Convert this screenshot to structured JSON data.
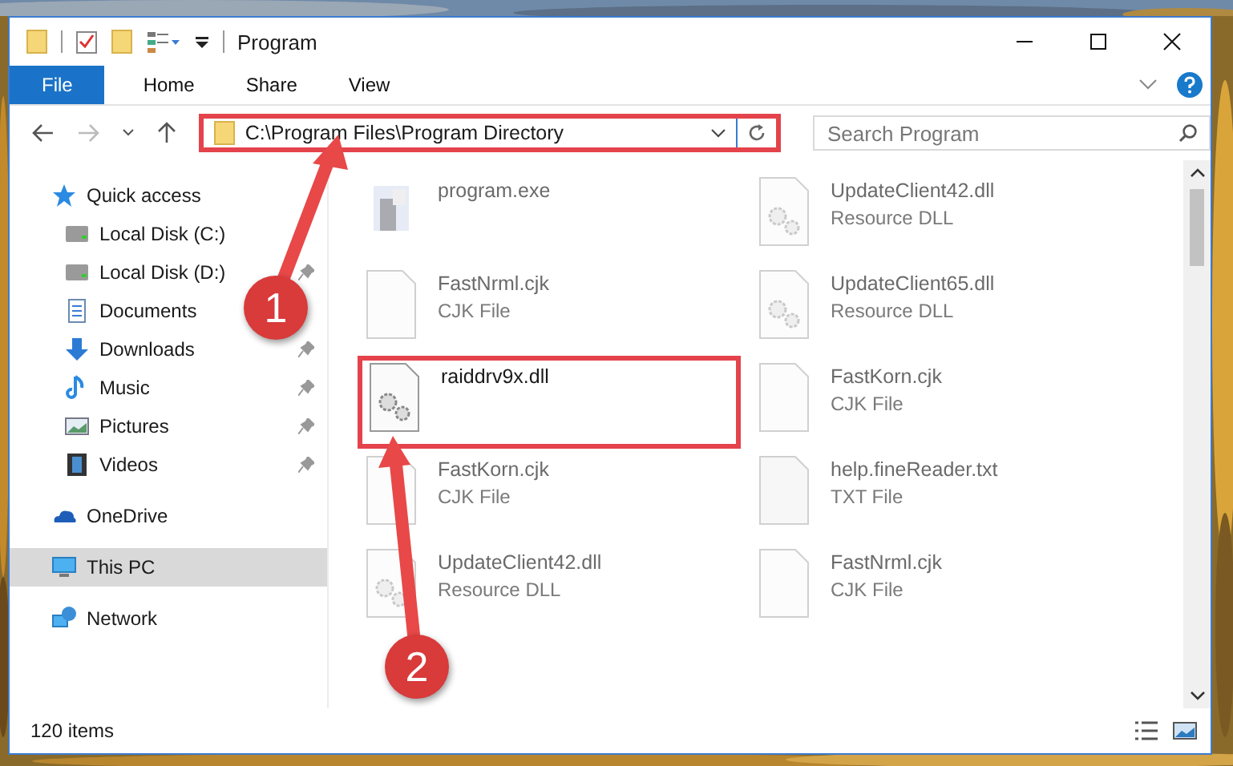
{
  "window": {
    "title": "Program"
  },
  "ribbon_tabs": [
    {
      "label": "File",
      "selected": true
    },
    {
      "label": "Home",
      "selected": false
    },
    {
      "label": "Share",
      "selected": false
    },
    {
      "label": "View",
      "selected": false
    }
  ],
  "address": {
    "path": "C:\\Program Files\\Program Directory",
    "highlighted": true
  },
  "search": {
    "placeholder": "Search Program"
  },
  "sidebar": {
    "items": [
      {
        "label": "Quick access",
        "kind": "star",
        "selected": false,
        "children": [
          {
            "label": "Local Disk (C:)",
            "kind": "drive",
            "pinned": false,
            "selected": false
          },
          {
            "label": "Local Disk (D:)",
            "kind": "drive",
            "pinned": true,
            "selected": false
          },
          {
            "label": "Documents",
            "kind": "document",
            "pinned": false,
            "selected": false
          },
          {
            "label": "Downloads",
            "kind": "download",
            "pinned": true,
            "selected": false
          },
          {
            "label": "Music",
            "kind": "music",
            "pinned": true,
            "selected": false
          },
          {
            "label": "Pictures",
            "kind": "pictures",
            "pinned": true,
            "selected": false
          },
          {
            "label": "Videos",
            "kind": "videos",
            "pinned": true,
            "selected": false
          }
        ]
      },
      {
        "label": "OneDrive",
        "kind": "cloud",
        "selected": false
      },
      {
        "label": "This PC",
        "kind": "pc",
        "selected": true
      },
      {
        "label": "Network",
        "kind": "network",
        "selected": false
      }
    ]
  },
  "files": [
    {
      "name": "program.exe",
      "kind": "exe",
      "blurred": true,
      "highlighted": false
    },
    {
      "name": "UpdateClient42.dll",
      "type": "Resource DLL",
      "kind": "dll",
      "blurred": true,
      "highlighted": false
    },
    {
      "name": "FastNrml.cjk",
      "type": "CJK File",
      "kind": "file",
      "blurred": true,
      "highlighted": false
    },
    {
      "name": "UpdateClient65.dll",
      "type": "Resource DLL",
      "kind": "dll",
      "blurred": true,
      "highlighted": false
    },
    {
      "name": "raiddrv9x.dll",
      "kind": "dll",
      "blurred": false,
      "highlighted": true
    },
    {
      "name": "FastKorn.cjk",
      "type": "CJK File",
      "kind": "file",
      "blurred": true,
      "highlighted": false
    },
    {
      "name": "FastKorn.cjk",
      "type": "CJK File",
      "kind": "file",
      "blurred": true,
      "highlighted": false
    },
    {
      "name": "help.fineReader.txt",
      "type": "TXT File",
      "kind": "txt",
      "blurred": true,
      "highlighted": false
    },
    {
      "name": "UpdateClient42.dll",
      "type": "Resource DLL",
      "kind": "dll",
      "blurred": true,
      "highlighted": false
    },
    {
      "name": "FastNrml.cjk",
      "type": "CJK File",
      "kind": "file",
      "blurred": true,
      "highlighted": false
    }
  ],
  "status_bar": {
    "count": "120 items"
  },
  "annotations": [
    {
      "number": "1"
    },
    {
      "number": "2"
    }
  ]
}
